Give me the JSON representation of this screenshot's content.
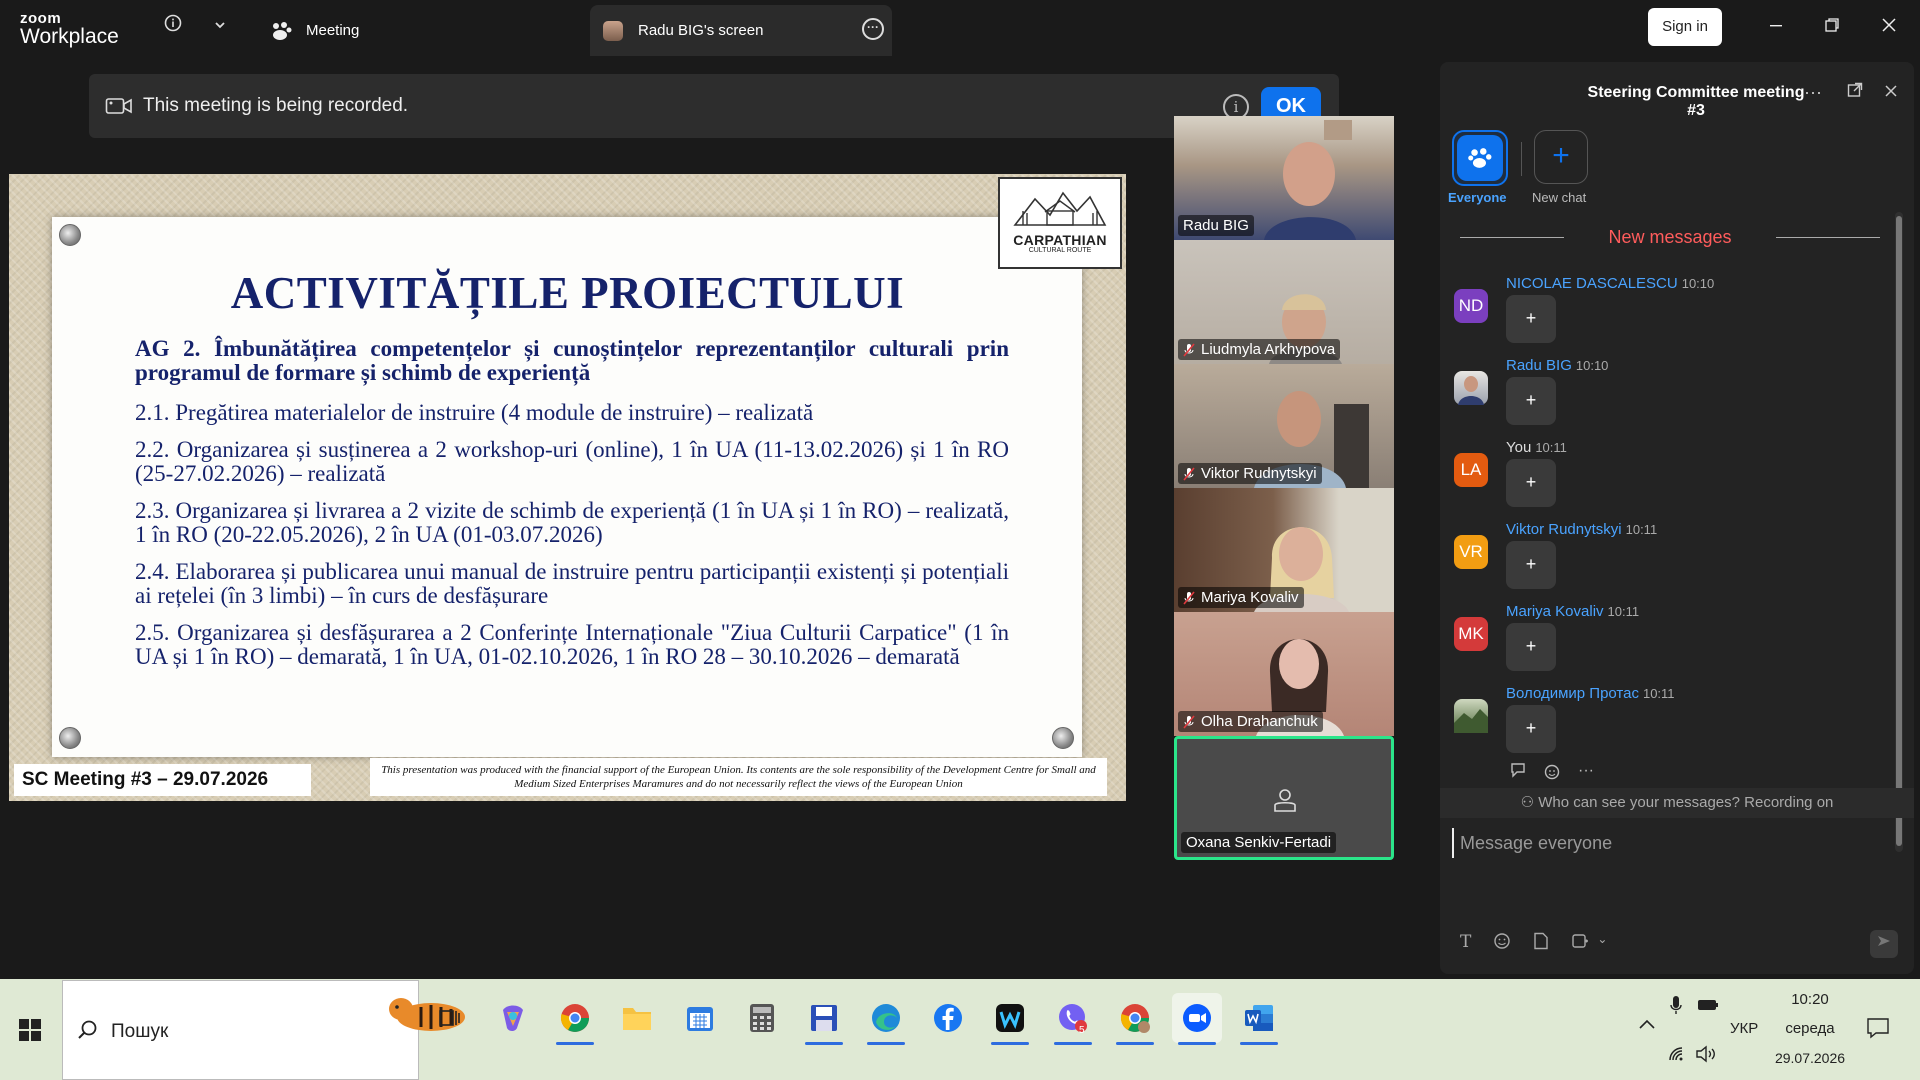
{
  "app": {
    "brand_small": "zoom",
    "brand_big": "Workplace"
  },
  "tabs": {
    "meeting_label": "Meeting",
    "screen_label": "Radu BIG's screen"
  },
  "header": {
    "signin_label": "Sign in"
  },
  "recording_banner": {
    "text": "This meeting is being recorded.",
    "ok_label": "OK"
  },
  "slide": {
    "title": "ACTIVITĂȚILE PROIECTULUI",
    "logo_line1": "CARPATHIAN",
    "logo_line2": "CULTURAL ROUTE",
    "ag2": "AG 2. Îmbunătățirea competențelor și cunoștințelor reprezentanților culturali prin programul de formare și schimb de experiență",
    "items": [
      "2.1. Pregătirea materialelor de instruire (4 module de instruire) – realizată",
      "2.2. Organizarea și susținerea a 2 workshop-uri (online), 1 în UA (11-13.02.2026) și 1 în RO (25-27.02.2026) – realizată",
      "2.3. Organizarea și livrarea a 2 vizite de schimb de experiență (1 în UA și 1 în RO) – realizată, 1 în RO (20-22.05.2026), 2 în UA (01-03.07.2026)",
      "2.4. Elaborarea și publicarea unui manual de instruire pentru participanții existenți și potențiali ai rețelei (în 3 limbi) – în curs de desfășurare",
      "2.5. Organizarea și desfășurarea a 2 Conferințe Internaționale \"Ziua Culturii Carpatice\" (1 în UA și 1 în RO) – demarată, 1 în UA, 01-02.10.2026, 1 în RO 28 – 30.10.2026 – demarată"
    ],
    "footer_left": "SC Meeting #3 – 29.07.2026",
    "footer_right": "This presentation was produced with the financial support of the European Union. Its contents are the sole responsibility of the Development Centre for Small and Medium Sized Enterprises Maramures and do not necessarily reflect the views of the European Union"
  },
  "participants": [
    {
      "name": "Radu BIG",
      "muted": false,
      "bg": "#8a7a70"
    },
    {
      "name": "Liudmyla Arkhypova",
      "muted": true,
      "bg": "#b5aea4"
    },
    {
      "name": "Viktor Rudnytskyi",
      "muted": true,
      "bg": "#9a8f84"
    },
    {
      "name": "Mariya Kovaliv",
      "muted": true,
      "bg": "#6b5040"
    },
    {
      "name": "Olha Drahanchuk",
      "muted": true,
      "bg": "#c49a86"
    },
    {
      "name": "Oxana Senkiv-Fertadi",
      "muted": false,
      "bg": "#4a4a4a"
    }
  ],
  "chat": {
    "title": "Steering Committee meeting #3",
    "everyone_label": "Everyone",
    "new_chat_label": "New chat",
    "new_messages_label": "New messages",
    "messages": [
      {
        "initials": "ND",
        "sender": "NICOLAE DASCALESCU",
        "time": "10:10",
        "content": "+",
        "color": "#7b3fbf",
        "self": false
      },
      {
        "initials": "",
        "sender": "Radu BIG",
        "time": "10:10",
        "content": "+",
        "color": "#d9d9d9",
        "self": false
      },
      {
        "initials": "LA",
        "sender": "You",
        "time": "10:11",
        "content": "+",
        "color": "#e35b10",
        "self": true
      },
      {
        "initials": "VR",
        "sender": "Viktor Rudnytskyi",
        "time": "10:11",
        "content": "+",
        "color": "#f29d12",
        "self": false
      },
      {
        "initials": "MK",
        "sender": "Mariya Kovaliv",
        "time": "10:11",
        "content": "+",
        "color": "#d43a3a",
        "self": false
      },
      {
        "initials": "",
        "sender": "Володимир Протас",
        "time": "10:11",
        "content": "+",
        "color": "#5d7a4a",
        "self": false
      }
    ],
    "visibility_notice": "Who can see your messages? Recording on",
    "input_placeholder": "Message everyone"
  },
  "taskbar": {
    "search_label": "Пошук",
    "lang": "УКР",
    "time": "10:20",
    "day": "середа",
    "date": "29.07.2026",
    "badge_count": "5"
  },
  "colors": {
    "accent": "#0e72ed",
    "active_speaker": "#2be58a",
    "slide_text": "#15226b",
    "new_messages": "#ff5c5c"
  }
}
